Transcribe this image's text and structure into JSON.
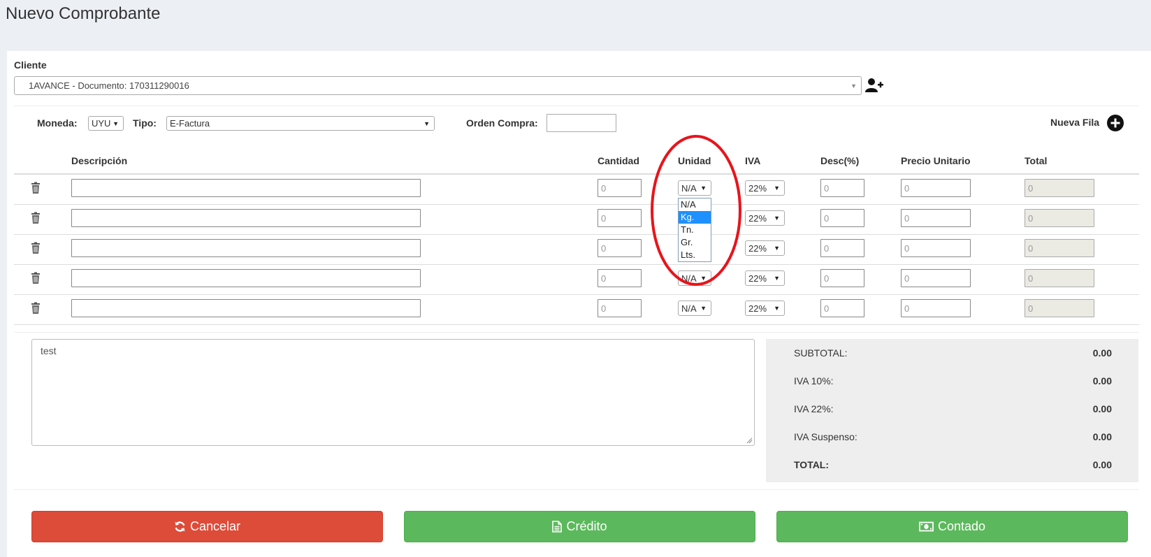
{
  "page": {
    "title": "Nuevo Comprobante"
  },
  "cliente": {
    "label": "Cliente",
    "value": "1AVANCE - Documento: 170311290016",
    "add_icon": "user-plus-icon"
  },
  "controls": {
    "moneda_label": "Moneda:",
    "moneda_value": "UYU",
    "tipo_label": "Tipo:",
    "tipo_value": "E-Factura",
    "orden_label": "Orden Compra:",
    "orden_value": "",
    "nueva_fila_label": "Nueva Fila"
  },
  "table": {
    "headers": {
      "descripcion": "Descripción",
      "cantidad": "Cantidad",
      "unidad": "Unidad",
      "iva": "IVA",
      "desc": "Desc(%)",
      "precio": "Precio Unitario",
      "total": "Total"
    },
    "rows": [
      {
        "descripcion": "",
        "cantidad": "0",
        "unidad": "N/A",
        "iva": "22%",
        "desc": "0",
        "precio": "0",
        "total": "0"
      },
      {
        "descripcion": "",
        "cantidad": "0",
        "unidad": "N/A",
        "iva": "22%",
        "desc": "0",
        "precio": "0",
        "total": "0"
      },
      {
        "descripcion": "",
        "cantidad": "0",
        "unidad": "N/A",
        "iva": "22%",
        "desc": "0",
        "precio": "0",
        "total": "0"
      },
      {
        "descripcion": "",
        "cantidad": "0",
        "unidad": "N/A",
        "iva": "22%",
        "desc": "0",
        "precio": "0",
        "total": "0"
      },
      {
        "descripcion": "",
        "cantidad": "0",
        "unidad": "N/A",
        "iva": "22%",
        "desc": "0",
        "precio": "0",
        "total": "0"
      }
    ]
  },
  "unidad_dropdown": {
    "options": [
      "N/A",
      "Kg.",
      "Tn.",
      "Gr.",
      "Lts."
    ],
    "highlighted": "Kg.",
    "annotation_color": "#e8141c"
  },
  "notes": {
    "value": "test"
  },
  "summary": {
    "subtotal_label": "SUBTOTAL:",
    "subtotal_value": "0.00",
    "iva10_label": "IVA 10%:",
    "iva10_value": "0.00",
    "iva22_label": "IVA 22%:",
    "iva22_value": "0.00",
    "suspenso_label": "IVA Suspenso:",
    "suspenso_value": "0.00",
    "total_label": "TOTAL:",
    "total_value": "0.00"
  },
  "buttons": {
    "cancelar": "Cancelar",
    "credito": "Crédito",
    "contado": "Contado"
  },
  "colors": {
    "danger": "#dd4b39",
    "success": "#5cb85c",
    "background": "#ecf0f5"
  }
}
